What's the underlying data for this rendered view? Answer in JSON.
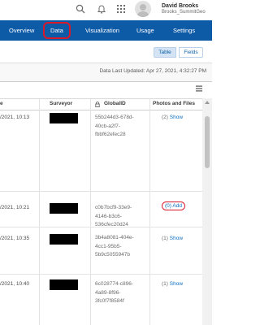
{
  "header": {
    "user_name": "David Brooks",
    "user_handle": "Brooks_SummitGeo"
  },
  "nav": {
    "tabs": [
      {
        "label": "Overview"
      },
      {
        "label": "Data"
      },
      {
        "label": "Visualization"
      },
      {
        "label": "Usage"
      },
      {
        "label": "Settings"
      }
    ],
    "active_tab": "Data"
  },
  "toolbar": {
    "table_label": "Table",
    "fields_label": "Fields"
  },
  "info": {
    "last_updated": "Data Last Updated: Apr 27, 2021, 4:32:27 PM"
  },
  "table": {
    "columns": [
      "e",
      "Surveyor",
      "GlobalID",
      "Photos and Files"
    ],
    "rows": [
      {
        "date": "/2021, 10:13",
        "surveyor": "",
        "guid": [
          "55b244d3-678d-",
          "40cb-a2f7-",
          "fbbf62efec28"
        ],
        "photos_count": "(2)",
        "photos_action": "Show"
      },
      {
        "date": "/2021, 10:21",
        "surveyor": "",
        "guid": [
          "c0b7bcf9-33e9-",
          "4146-b3c6-",
          "536cfec20d24"
        ],
        "photos_count": "(0)",
        "photos_action": "Add"
      },
      {
        "date": "/2021, 10:35",
        "surveyor": "",
        "guid": [
          "3b4a8081-404e-",
          "4cc1-95b5-",
          "5b9c5055947b"
        ],
        "photos_count": "(1)",
        "photos_action": "Show"
      },
      {
        "date": "/2021, 10:40",
        "surveyor": "",
        "guid": [
          "6c028774-c896-",
          "4a89-8f96-",
          "3fc0f7f8584f"
        ],
        "photos_count": "(1)",
        "photos_action": "Show"
      }
    ]
  },
  "colors": {
    "nav_bg": "#0d5aa7",
    "annotation_red": "#d8192c",
    "link": "#0b6fc0"
  }
}
